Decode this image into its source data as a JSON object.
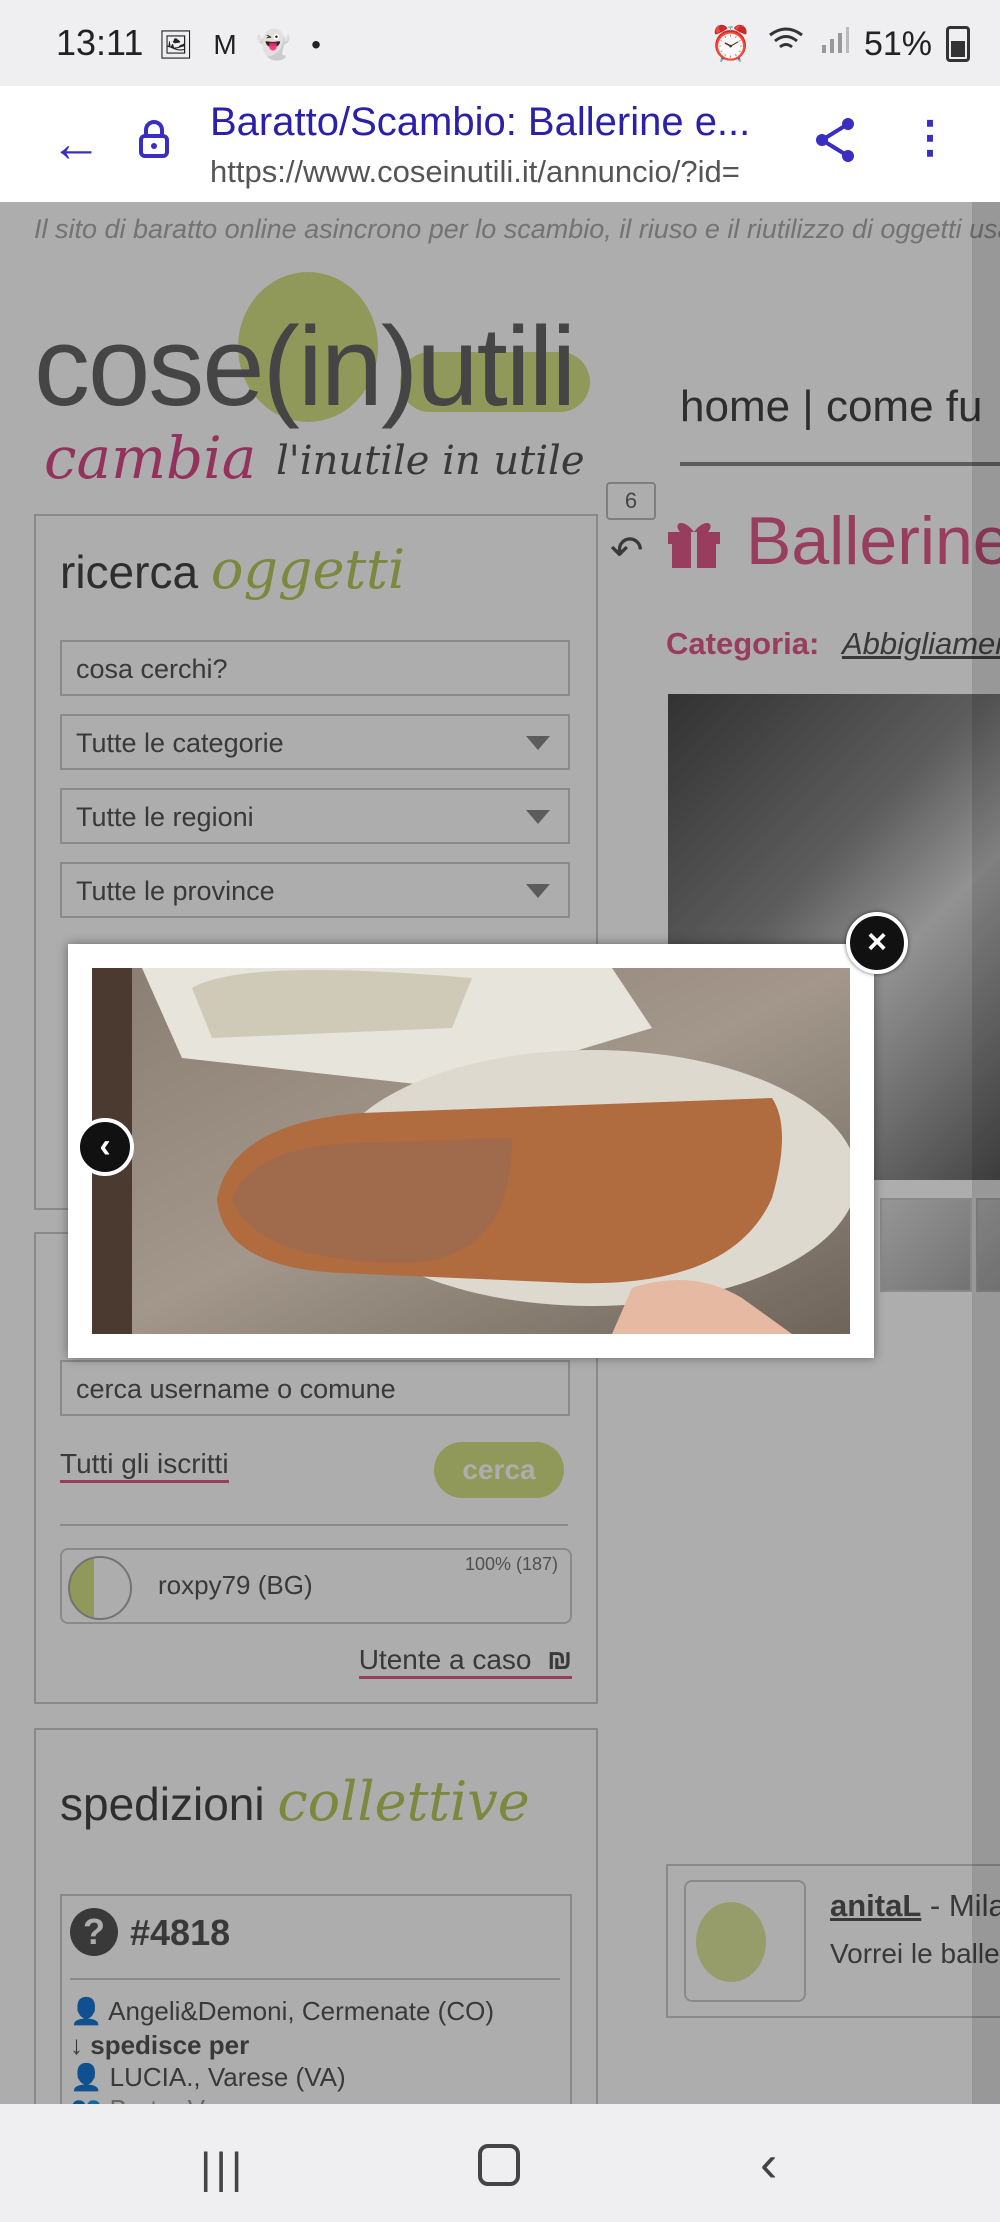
{
  "status_bar": {
    "time": "13:11",
    "notification_icons": "🖼 M 👻 •",
    "battery": "51%"
  },
  "browser": {
    "page_title": "Baratto/Scambio: Ballerine e...",
    "url": "https://www.coseinutili.it/annuncio/?id=",
    "icons": [
      "back-arrow-icon",
      "lock-icon",
      "share-icon",
      "more-vert-icon"
    ]
  },
  "site": {
    "tagline": "Il sito di baratto online asincrono per lo scambio, il riuso e il riutilizzo di oggetti usati,",
    "logo_main": "cose(in)utili",
    "logo_sub_a": "cambia",
    "logo_sub_b": "l'inutile in utile",
    "nav_text": "home | come fu",
    "search_panel": {
      "title_plain": "ricerca",
      "title_accent": "oggetti",
      "query_placeholder": "cosa cerchi?",
      "category_select": "Tutte le categorie",
      "region_select": "Tutte le regioni",
      "province_select": "Tutte le province"
    },
    "users_panel": {
      "search_placeholder": "cerca username o comune",
      "all_users_link": "Tutti gli iscritti",
      "search_button": "cerca",
      "user_name": "roxpy79 (BG)",
      "user_rating": "100% (187)",
      "random_user_link": "Utente a caso"
    },
    "shipments_panel": {
      "title_plain": "spedizioni",
      "title_accent": "collettive",
      "shipment_id": "#4818",
      "sender": "Angeli&Demoni, Cermenate (CO)",
      "ships_for_label": "spedisce per",
      "receiver": "LUCIA., Varese (VA)",
      "group": "Barter Varese"
    },
    "listing": {
      "count_badge": "6",
      "title": "Ballerine",
      "category_label": "Categoria:",
      "category_value": "Abbigliamen"
    },
    "message": {
      "user": "anitaL",
      "location": "- Mila",
      "text": "Vorrei le balle"
    }
  },
  "lightbox": {
    "close_label": "×",
    "prev_label": "‹"
  },
  "colors": {
    "brand_pink": "#e05a8a",
    "brand_green": "#d6e285",
    "link_blue": "#2b20a8"
  }
}
